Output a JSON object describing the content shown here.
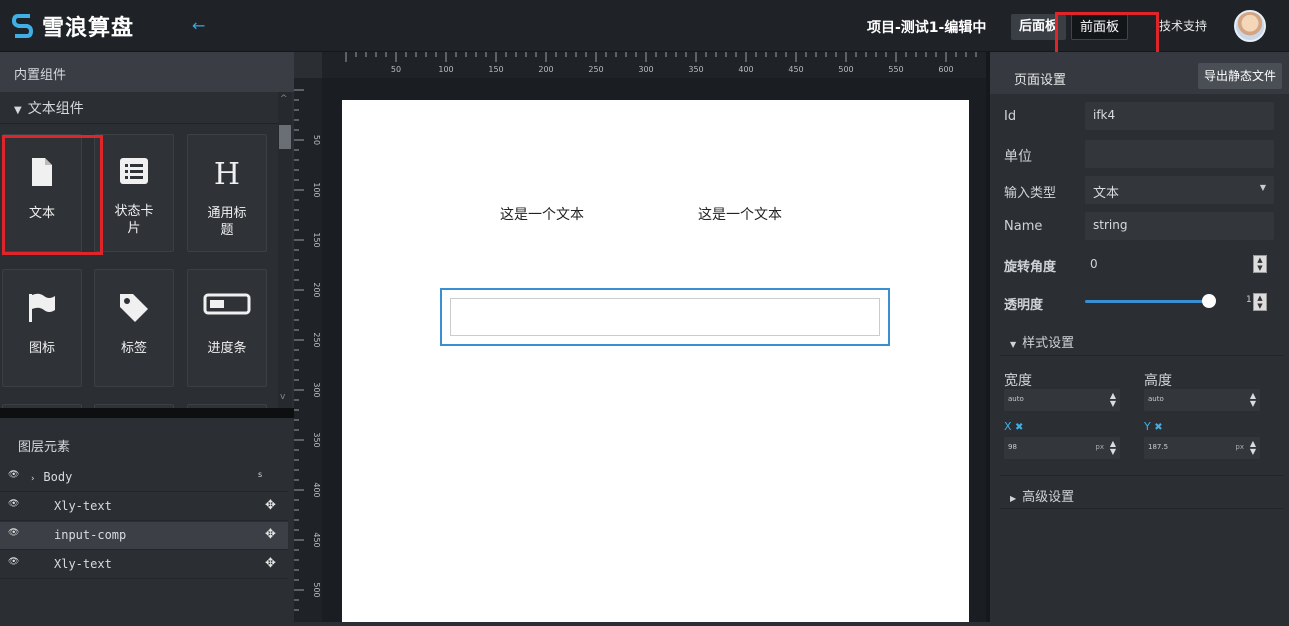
{
  "header": {
    "logo_text": "雪浪算盘",
    "project_title": "项目-测试1-编辑中",
    "back_panel_label": "后面板",
    "front_panel_label": "前面板",
    "tech_support_label": "技术支持"
  },
  "left_panel": {
    "section_title": "内置组件",
    "group_title": "文本组件",
    "components": [
      {
        "label": "文本",
        "icon": "document-icon"
      },
      {
        "label": "状态卡片",
        "icon": "list-card-icon"
      },
      {
        "label": "通用标题",
        "icon": "heading-icon"
      },
      {
        "label": "图标",
        "icon": "flag-icon"
      },
      {
        "label": "标签",
        "icon": "tag-icon"
      },
      {
        "label": "进度条",
        "icon": "progress-bar-icon"
      }
    ],
    "heading_glyph": "H",
    "layers_title": "图层元素",
    "layers": [
      {
        "name": "Body",
        "badge": "s"
      },
      {
        "name": "Xly-text"
      },
      {
        "name": "input-comp"
      },
      {
        "name": "Xly-text"
      }
    ]
  },
  "ruler": {
    "top_ticks": [
      "50",
      "100",
      "150",
      "200",
      "250",
      "300",
      "350",
      "400",
      "450",
      "500",
      "550",
      "600"
    ],
    "left_ticks": [
      "50",
      "100",
      "150",
      "200",
      "250",
      "300",
      "350",
      "400",
      "450",
      "500"
    ]
  },
  "canvas": {
    "text_1": "这是一个文本",
    "text_2": "这是一个文本"
  },
  "right_panel": {
    "title": "页面设置",
    "export_label": "导出静态文件",
    "id_label": "Id",
    "id_value": "ifk4",
    "unit_label": "单位",
    "unit_value": "",
    "input_type_label": "输入类型",
    "input_type_value": "文本",
    "name_label": "Name",
    "name_value": "string",
    "rotation_label": "旋转角度",
    "rotation_value": "0",
    "opacity_label": "透明度",
    "opacity_value": "1",
    "style_section": "样式设置",
    "width_label": "宽度",
    "width_value": "auto",
    "height_label": "高度",
    "height_value": "auto",
    "x_label": "X",
    "x_value": "98",
    "y_label": "Y",
    "y_value": "187.5",
    "unit_px": "px",
    "advanced_section": "高级设置"
  },
  "colors": {
    "accent": "#3a8fd0",
    "highlight": "#e0252a"
  }
}
